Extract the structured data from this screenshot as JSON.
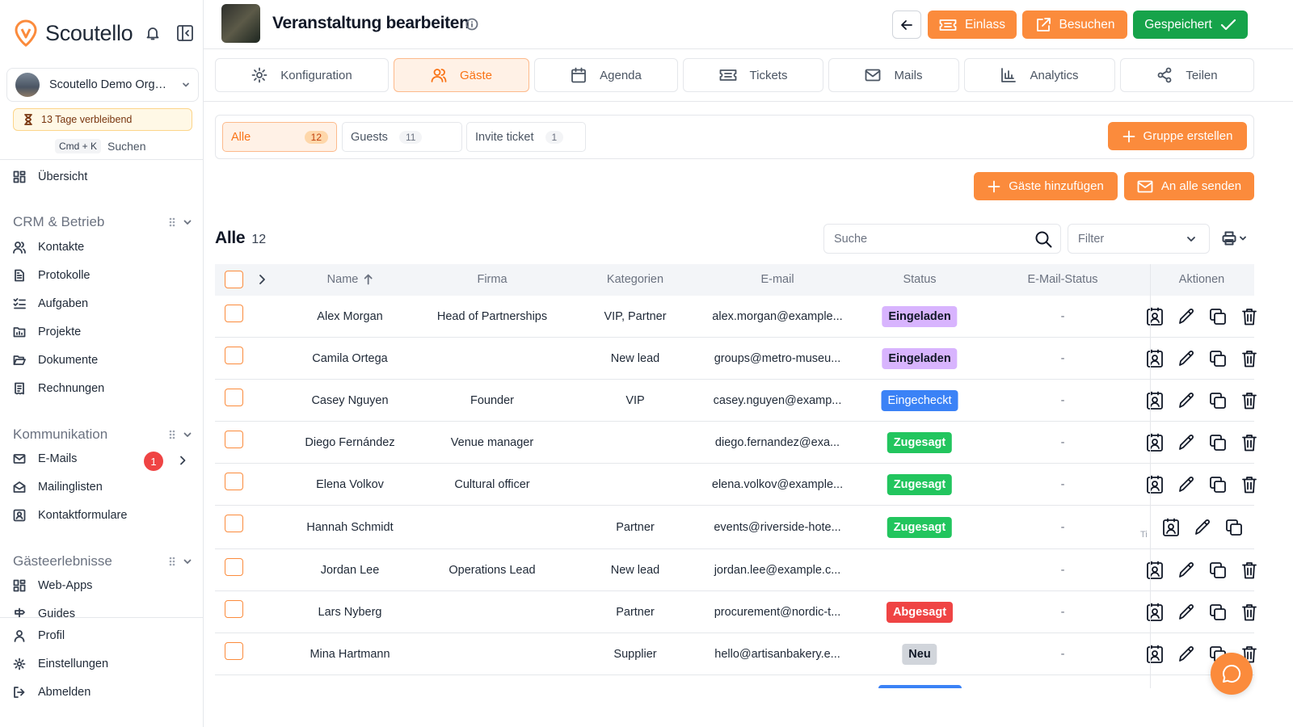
{
  "brand": {
    "name": "Scoutello",
    "accent": "#fb8b3c"
  },
  "sidebar": {
    "org_name": "Scoutello Demo Org…",
    "trial": "13 Tage verbleibend",
    "shortcut": "Cmd + K",
    "search_label": "Suchen",
    "overview": "Übersicht",
    "sections": [
      {
        "title": "CRM & Betrieb",
        "items": [
          "Kontakte",
          "Protokolle",
          "Aufgaben",
          "Projekte",
          "Dokumente",
          "Rechnungen"
        ]
      },
      {
        "title": "Kommunikation",
        "items": [
          "E-Mails",
          "Mailinglisten",
          "Kontaktformulare"
        ]
      },
      {
        "title": "Gästeerlebnisse",
        "items": [
          "Web-Apps",
          "Guides"
        ]
      }
    ],
    "email_badge": "1",
    "bottom": [
      "Profil",
      "Einstellungen",
      "Abmelden"
    ]
  },
  "header": {
    "title": "Veranstaltung bearbeiten",
    "buttons": {
      "checkin": "Einlass",
      "visit": "Besuchen",
      "saved": "Gespeichert"
    }
  },
  "tabs": [
    "Konfiguration",
    "Gäste",
    "Agenda",
    "Tickets",
    "Mails",
    "Analytics",
    "Teilen"
  ],
  "groups": {
    "chips": [
      {
        "label": "Alle",
        "count": "12"
      },
      {
        "label": "Guests",
        "count": "11"
      },
      {
        "label": "Invite ticket",
        "count": "1"
      }
    ],
    "create": "Gruppe erstellen"
  },
  "actions": {
    "add_guests": "Gäste hinzufügen",
    "send_all": "An alle senden"
  },
  "list": {
    "title": "Alle",
    "count": "12",
    "search_placeholder": "Suche",
    "filter_placeholder": "Filter"
  },
  "table": {
    "columns": [
      "Name",
      "Firma",
      "Kategorien",
      "E-mail",
      "Status",
      "E-Mail-Status",
      "Aktionen"
    ],
    "rows": [
      {
        "name": "Alex Morgan",
        "company": "Head of Partnerships",
        "categories": "VIP, Partner",
        "email": "alex.morgan@example...",
        "status": "Eingeladen",
        "status_color": "#d8b4fe",
        "mail_status": "-"
      },
      {
        "name": "Camila Ortega",
        "company": "",
        "categories": "New lead",
        "email": "groups@metro-museu...",
        "status": "Eingeladen",
        "status_color": "#d8b4fe",
        "mail_status": "-"
      },
      {
        "name": "Casey Nguyen",
        "company": "Founder",
        "categories": "VIP",
        "email": "casey.nguyen@examp...",
        "status": "Eingecheckt",
        "status_color": "#3b82f6",
        "mail_status": "-"
      },
      {
        "name": "Diego Fernández",
        "company": "Venue manager",
        "categories": "",
        "email": "diego.fernandez@exa...",
        "status": "Zugesagt",
        "status_color": "#22c55e",
        "mail_status": "-"
      },
      {
        "name": "Elena Volkov",
        "company": "Cultural officer",
        "categories": "",
        "email": "elena.volkov@example...",
        "status": "Zugesagt",
        "status_color": "#22c55e",
        "mail_status": "-"
      },
      {
        "name": "Hannah Schmidt",
        "company": "",
        "categories": "Partner",
        "email": "events@riverside-hote...",
        "status": "Zugesagt",
        "status_color": "#22c55e",
        "mail_status": "-"
      },
      {
        "name": "Jordan Lee",
        "company": "Operations Lead",
        "categories": "New lead",
        "email": "jordan.lee@example.c...",
        "status": "",
        "status_color": "",
        "mail_status": "-"
      },
      {
        "name": "Lars Nyberg",
        "company": "",
        "categories": "Partner",
        "email": "procurement@nordic-t...",
        "status": "Abgesagt",
        "status_color": "#ef4444",
        "mail_status": "-"
      },
      {
        "name": "Mina Hartmann",
        "company": "",
        "categories": "Supplier",
        "email": "hello@artisanbakery.e...",
        "status": "Neu",
        "status_color": "#d1d5db",
        "mail_status": "-"
      }
    ],
    "tooltip_fragment": "Ti"
  }
}
